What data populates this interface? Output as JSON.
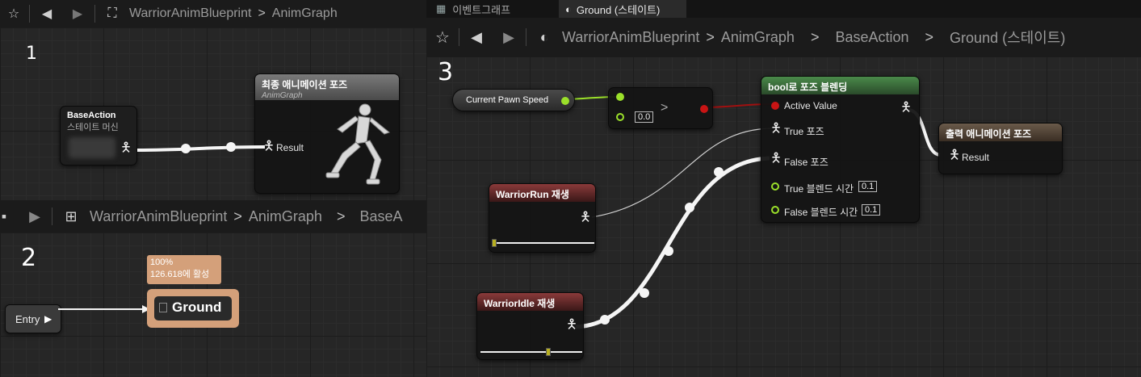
{
  "panel1": {
    "breadcrumb": [
      "WarriorAnimBlueprint",
      "AnimGraph"
    ],
    "annotation": "1",
    "base_action_node": {
      "title": "BaseAction",
      "subtitle": "스테이트 머신"
    },
    "final_pose_node": {
      "title": "최종 애니메이션 포즈",
      "subtitle": "AnimGraph",
      "pin": "Result"
    }
  },
  "panel2": {
    "breadcrumb": [
      "WarriorAnimBlueprint",
      "AnimGraph",
      "BaseA"
    ],
    "annotation": "2",
    "entry_label": "Entry",
    "state_tooltip": [
      "100%",
      "126.618에 활성"
    ],
    "state_name": "Ground"
  },
  "panel3": {
    "tabs": [
      {
        "label": "이벤트그래프"
      },
      {
        "label": "Ground (스테이트)"
      }
    ],
    "breadcrumb": [
      "WarriorAnimBlueprint",
      "AnimGraph",
      "BaseAction",
      "Ground (스테이트)"
    ],
    "annotation": "3",
    "speed_node_label": "Current Pawn Speed",
    "compare_value": "0.0",
    "compare_op": ">",
    "blend_node": {
      "title": "bool로 포즈 블렌딩",
      "active_value": "Active Value",
      "true_pose": "True 포즈",
      "false_pose": "False 포즈",
      "true_blend_time": "True 블렌드 시간",
      "true_blend_value": "0.1",
      "false_blend_time": "False 블렌드 시간",
      "false_blend_value": "0.1"
    },
    "output_node": {
      "title": "출력 애니메이션 포즈",
      "pin": "Result"
    },
    "run_node": {
      "title": "WarriorRun 재생"
    },
    "idle_node": {
      "title": "WarriorIdle 재생"
    }
  },
  "colors": {
    "final_pose_header": "#6a6a6a",
    "blend_header": "#3d6b3d",
    "output_header": "#5a4a3a",
    "sequence_header": "#5a2a2a",
    "state_accent": "#d4a07a",
    "bool_pin": "#c81414",
    "float_pin": "#9be02a"
  }
}
